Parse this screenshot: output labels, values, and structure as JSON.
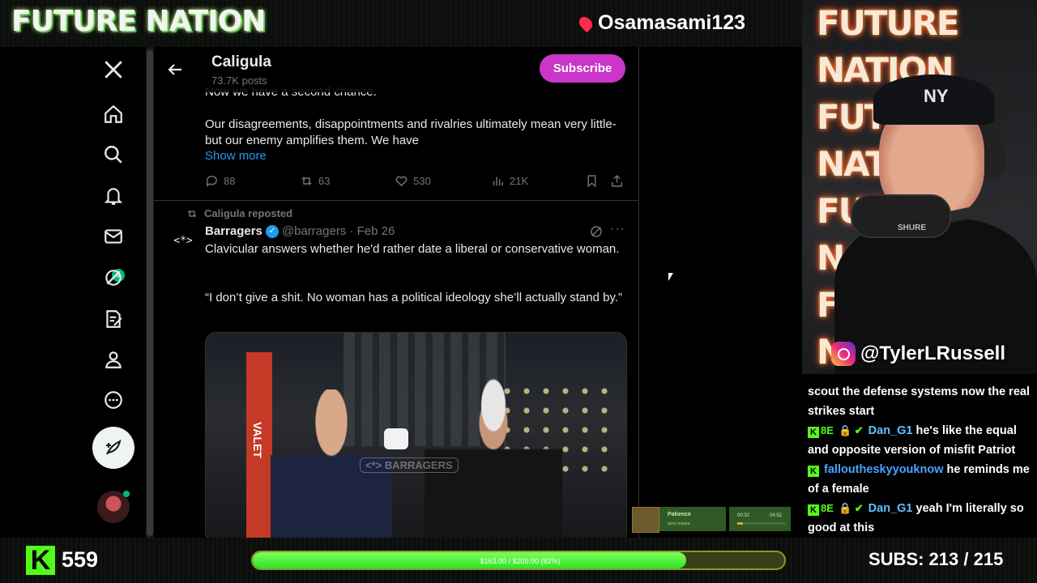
{
  "overlay": {
    "brand": "FUTURE NATION",
    "streamer": "Osamasami123",
    "kick_count": "559",
    "goal_text": "$163.00 / $200.00 (82%)",
    "goal_progress": 0.815,
    "subs": "SUBS:  213 / 215",
    "instagram": "@TylerLRussell",
    "cam_background_text": "FUTURE NATION\nFUTURE NATION\nFUTURE NATION\nFUTURE NATION",
    "cam_cap_logo": "NY",
    "cam_mic_brand": "SHURE"
  },
  "header": {
    "title": "Caligula",
    "subtitle": "73.7K posts",
    "subscribe_label": "Subscribe"
  },
  "sidebar": {
    "messages_badge": "1",
    "icons": [
      "x-logo-icon",
      "home-icon",
      "search-icon",
      "notifications-icon",
      "messages-icon",
      "grok-icon",
      "notes-icon",
      "profile-icon",
      "more-icon"
    ]
  },
  "post1": {
    "line0": "Now we have a second chance.",
    "body": "Our disagreements, disappointments and rivalries ultimately mean very little- but our enemy amplifies them. We have",
    "show_more": "Show more",
    "replies": "88",
    "reposts": "63",
    "likes": "530",
    "views": "21K"
  },
  "post2": {
    "repost_label": "Caligula reposted",
    "author_avatar": "<*>",
    "author": "Barragers",
    "verified_mark": "✓",
    "handle": "@barragers · Feb 26",
    "more": "···",
    "text1": "Clavicular answers whether he'd rather date a liberal or conservative woman.",
    "text2": "“I don’t give a shit. No woman has a political ideology she’ll actually stand by.”",
    "media_sign": "VALET",
    "media_watermark": "<*> BARRAGERS"
  },
  "music": {
    "title": "Patience",
    "artist": "tame impala",
    "time_current": "00:32",
    "time_total": "04:52",
    "progress": 0.11
  },
  "chat": [
    {
      "user": "",
      "text": "scout the defense systems now the real strikes start"
    },
    {
      "user": "Dan_G1",
      "text": "he's like the equal and opposite version of misfit Patriot"
    },
    {
      "user": "falloutheskyyouknow",
      "text": "he reminds me of a female"
    },
    {
      "user": "Dan_G1",
      "text": "yeah I'm literally so good at this"
    }
  ],
  "chat_badges": {
    "kick": "K",
    "emotes": "8E",
    "extras": "🔒 ✔"
  },
  "colors": {
    "accent": "#1d9bf0",
    "subscribe": "#c936c9",
    "kick": "#53fc18",
    "verified": "#1d9bf0"
  }
}
